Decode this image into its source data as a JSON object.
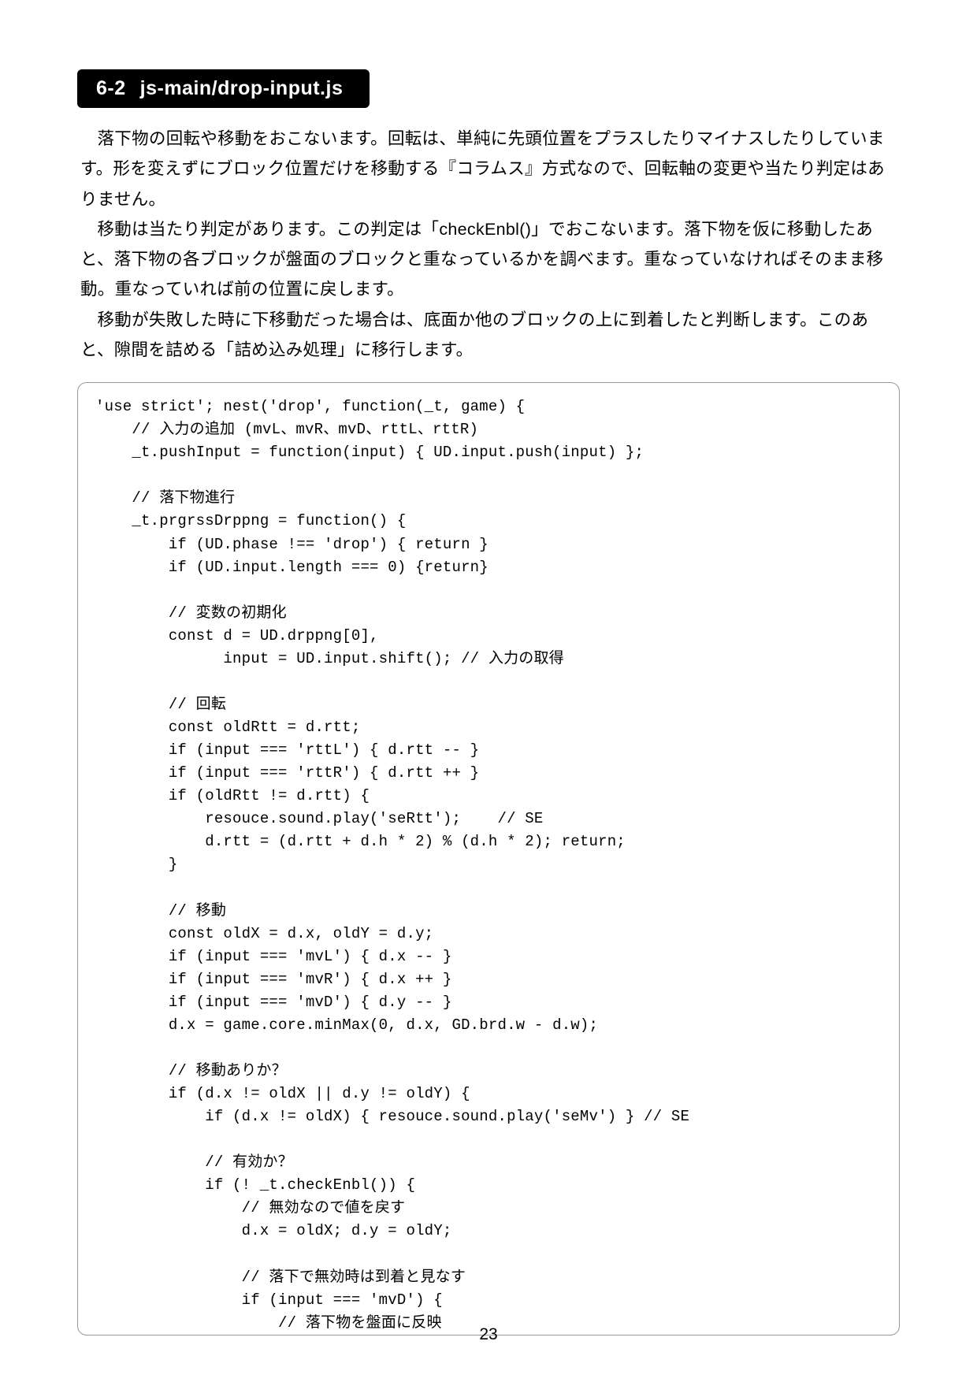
{
  "heading": {
    "number": "6-2",
    "path": "js-main/drop-input.js"
  },
  "paragraphs": [
    "落下物の回転や移動をおこないます。回転は、単純に先頭位置をプラスしたりマイナスしたりしています。形を変えずにブロック位置だけを移動する『コラムス』方式なので、回転軸の変更や当たり判定はありません。",
    "移動は当たり判定があります。この判定は「checkEnbl()」でおこないます。落下物を仮に移動したあと、落下物の各ブロックが盤面のブロックと重なっているかを調べます。重なっていなければそのまま移動。重なっていれば前の位置に戻します。",
    "移動が失敗した時に下移動だった場合は、底面か他のブロックの上に到着したと判断します。このあと、隙間を詰める「詰め込み処理」に移行します。"
  ],
  "code": "'use strict'; nest('drop', function(_t, game) {\n    // 入力の追加 (mvL、mvR、mvD、rttL、rttR)\n    _t.pushInput = function(input) { UD.input.push(input) };\n\n    // 落下物進行\n    _t.prgrssDrppng = function() {\n        if (UD.phase !== 'drop') { return }\n        if (UD.input.length === 0) {return}\n\n        // 変数の初期化\n        const d = UD.drppng[0],\n              input = UD.input.shift(); // 入力の取得\n\n        // 回転\n        const oldRtt = d.rtt;\n        if (input === 'rttL') { d.rtt -- }\n        if (input === 'rttR') { d.rtt ++ }\n        if (oldRtt != d.rtt) {\n            resouce.sound.play('seRtt');    // SE\n            d.rtt = (d.rtt + d.h * 2) % (d.h * 2); return;\n        }\n\n        // 移動\n        const oldX = d.x, oldY = d.y;\n        if (input === 'mvL') { d.x -- }\n        if (input === 'mvR') { d.x ++ }\n        if (input === 'mvD') { d.y -- }\n        d.x = game.core.minMax(0, d.x, GD.brd.w - d.w);\n\n        // 移動ありか？\n        if (d.x != oldX || d.y != oldY) {\n            if (d.x != oldX) { resouce.sound.play('seMv') } // SE\n\n            // 有効か？\n            if (! _t.checkEnbl()) {\n                // 無効なので値を戻す\n                d.x = oldX; d.y = oldY;\n\n                // 落下で無効時は到着と見なす\n                if (input === 'mvD') {\n                    // 落下物を盤面に反映",
  "pageNumber": "23"
}
